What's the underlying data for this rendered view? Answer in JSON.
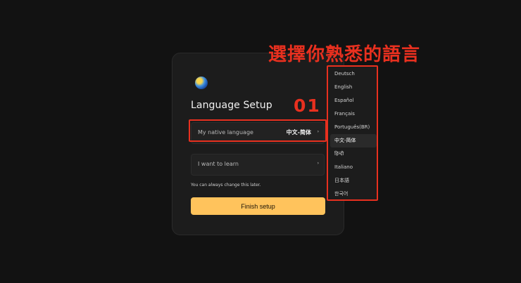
{
  "setup": {
    "title": "Language Setup",
    "native": {
      "label": "My native language",
      "value": "中文-简体"
    },
    "learn": {
      "label": "I want to learn",
      "value": ""
    },
    "hint": "You can always change this later.",
    "finish_label": "Finish setup",
    "chevron_glyph": "›"
  },
  "annotation": {
    "heading": "選擇你熟悉的語言",
    "step_number": "01",
    "color": "#e8301f"
  },
  "dropdown": {
    "items": [
      {
        "label": "Deutsch"
      },
      {
        "label": "English"
      },
      {
        "label": "Español"
      },
      {
        "label": "Français"
      },
      {
        "label": "Português(BR)"
      },
      {
        "label": "中文-简体",
        "selected": true
      },
      {
        "label": "हिन्दी"
      },
      {
        "label": "Italiano"
      },
      {
        "label": "日本語"
      },
      {
        "label": "한국어"
      }
    ]
  },
  "colors": {
    "background": "#121212",
    "card": "#1c1c1c",
    "accent_button": "#ffc35c"
  }
}
